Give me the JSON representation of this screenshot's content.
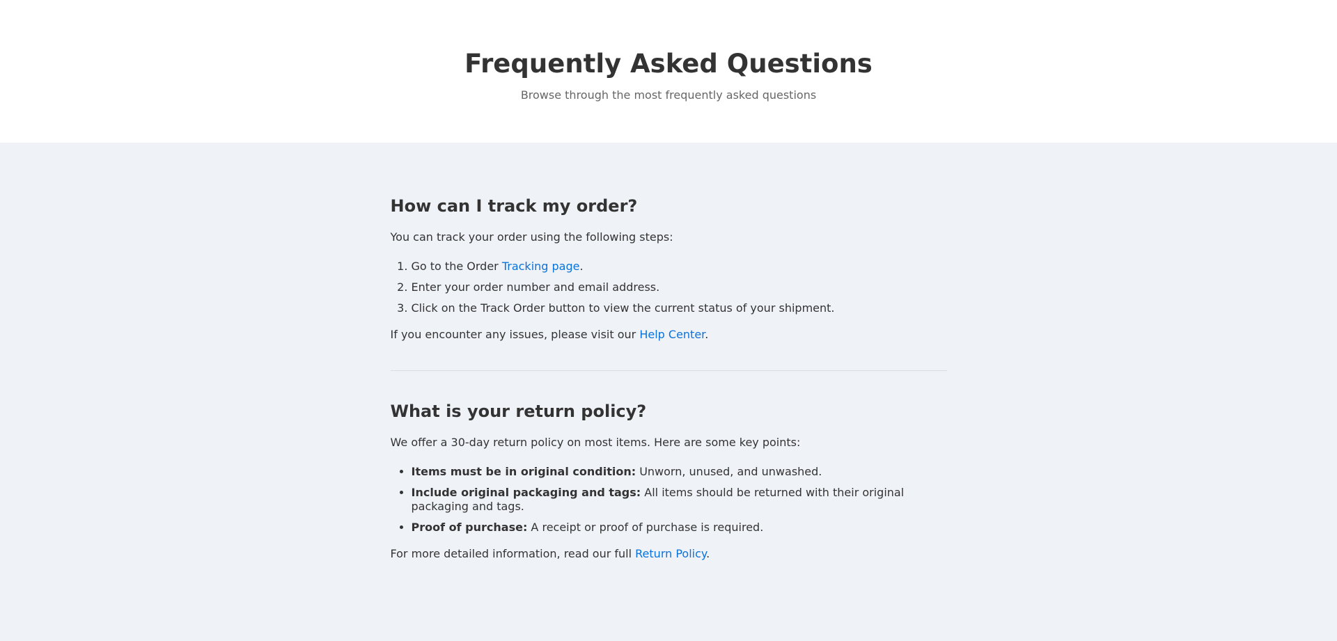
{
  "header": {
    "title": "Frequently Asked Questions",
    "subtitle": "Browse through the most frequently asked questions"
  },
  "faqs": [
    {
      "question": "How can I track my order?",
      "intro": "You can track your order using the following steps:",
      "steps": {
        "step1_prefix": "Go to the Order ",
        "step1_link": "Tracking page",
        "step1_suffix": ".",
        "step2": "Enter your order number and email address.",
        "step3": "Click on the Track Order button to view the current status of your shipment."
      },
      "outro_prefix": "If you encounter any issues, please visit our ",
      "outro_link": "Help Center",
      "outro_suffix": "."
    },
    {
      "question": "What is your return policy?",
      "intro": "We offer a 30-day return policy on most items. Here are some key points:",
      "points": [
        {
          "title": "Items must be in original condition:",
          "text": " Unworn, unused, and unwashed."
        },
        {
          "title": "Include original packaging and tags:",
          "text": " All items should be returned with their original packaging and tags."
        },
        {
          "title": "Proof of purchase:",
          "text": " A receipt or proof of purchase is required."
        }
      ],
      "outro_prefix": "For more detailed information, read our full ",
      "outro_link": "Return Policy",
      "outro_suffix": "."
    }
  ],
  "colors": {
    "page_background": "#eff2f7",
    "header_background": "#ffffff",
    "link": "#0b72d9",
    "text": "#333333"
  }
}
